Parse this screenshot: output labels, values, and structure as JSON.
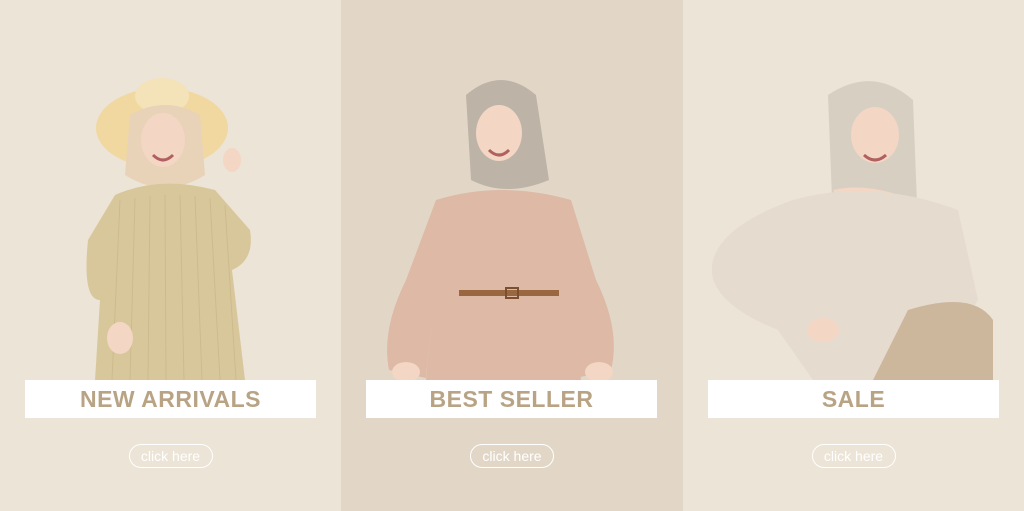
{
  "panels": [
    {
      "title": "NEW ARRIVALS",
      "button": "click here",
      "background": "#ece4d6",
      "garment_color": "#d9c79c"
    },
    {
      "title": "BEST SELLER",
      "button": "click here",
      "background": "#e2d7c7",
      "garment_color": "#ddb9a6"
    },
    {
      "title": "SALE",
      "button": "click here",
      "background": "#ece4d6",
      "garment_color": "#e6dbcf"
    }
  ],
  "colors": {
    "label_text": "#b9a385",
    "label_box": "#ffffff",
    "button_outline": "#ffffff"
  }
}
